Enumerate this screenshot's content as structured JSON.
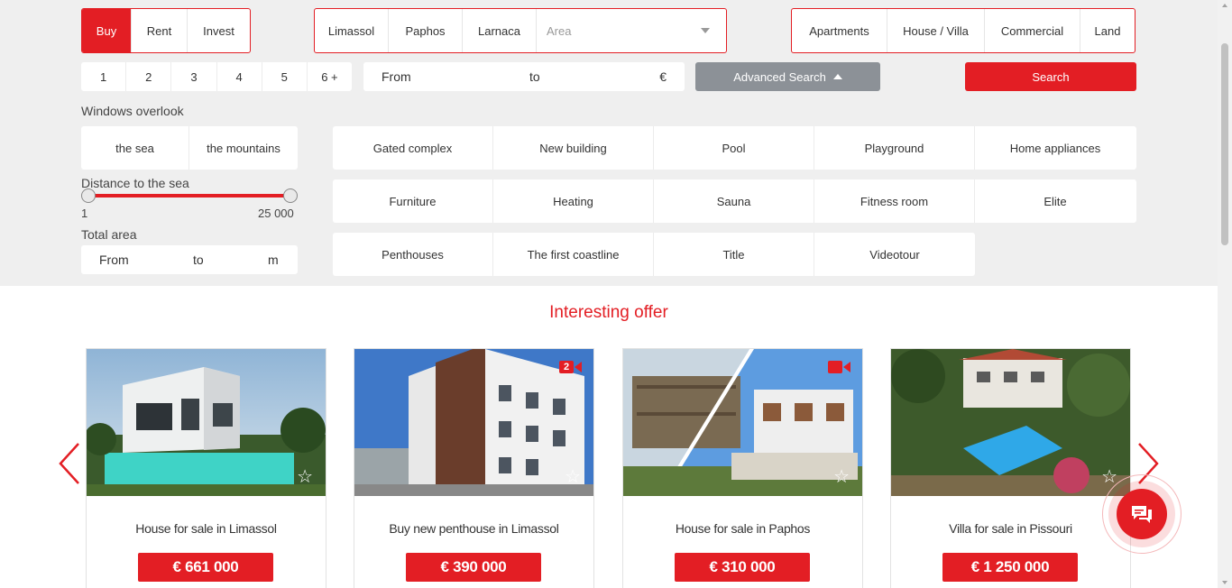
{
  "filters": {
    "deal_types": [
      "Buy",
      "Rent",
      "Invest"
    ],
    "active_deal": "Buy",
    "cities": [
      "Limassol",
      "Paphos",
      "Larnaca"
    ],
    "area_placeholder": "Area",
    "property_types": [
      "Apartments",
      "House / Villa",
      "Commercial",
      "Land"
    ],
    "rooms": [
      "1",
      "2",
      "3",
      "4",
      "5",
      "6 +"
    ],
    "price": {
      "from_label": "From",
      "to_label": "to",
      "currency": "€"
    },
    "advanced_search_label": "Advanced Search",
    "search_label": "Search"
  },
  "advanced": {
    "windows_overlook_label": "Windows overlook",
    "views": [
      "the sea",
      "the mountains"
    ],
    "distance_label": "Distance to the sea",
    "distance_min": "1",
    "distance_max": "25 000",
    "total_area_label": "Total area",
    "area_from": "From",
    "area_to": "to",
    "area_unit": "m",
    "features_row1": [
      "Gated complex",
      "New building",
      "Pool",
      "Playground",
      "Home appliances"
    ],
    "features_row2": [
      "Furniture",
      "Heating",
      "Sauna",
      "Fitness room",
      "Elite"
    ],
    "features_row3": [
      "Penthouses",
      "The first coastline",
      "Title",
      "Videotour"
    ]
  },
  "offers": {
    "section_title": "Interesting offer",
    "cards": [
      {
        "title": "House for sale in Limassol",
        "price": "€ 661 000"
      },
      {
        "title": "Buy new penthouse in Limassol",
        "price": "€ 390 000",
        "video_count": "2"
      },
      {
        "title": "House for sale in Paphos",
        "price": "€ 310 000"
      },
      {
        "title": "Villa for sale in Pissouri",
        "price": "€ 1 250 000"
      }
    ]
  },
  "colors": {
    "accent": "#e31e24",
    "panel_bg": "#efefef",
    "advanced_button": "#8c9197"
  }
}
